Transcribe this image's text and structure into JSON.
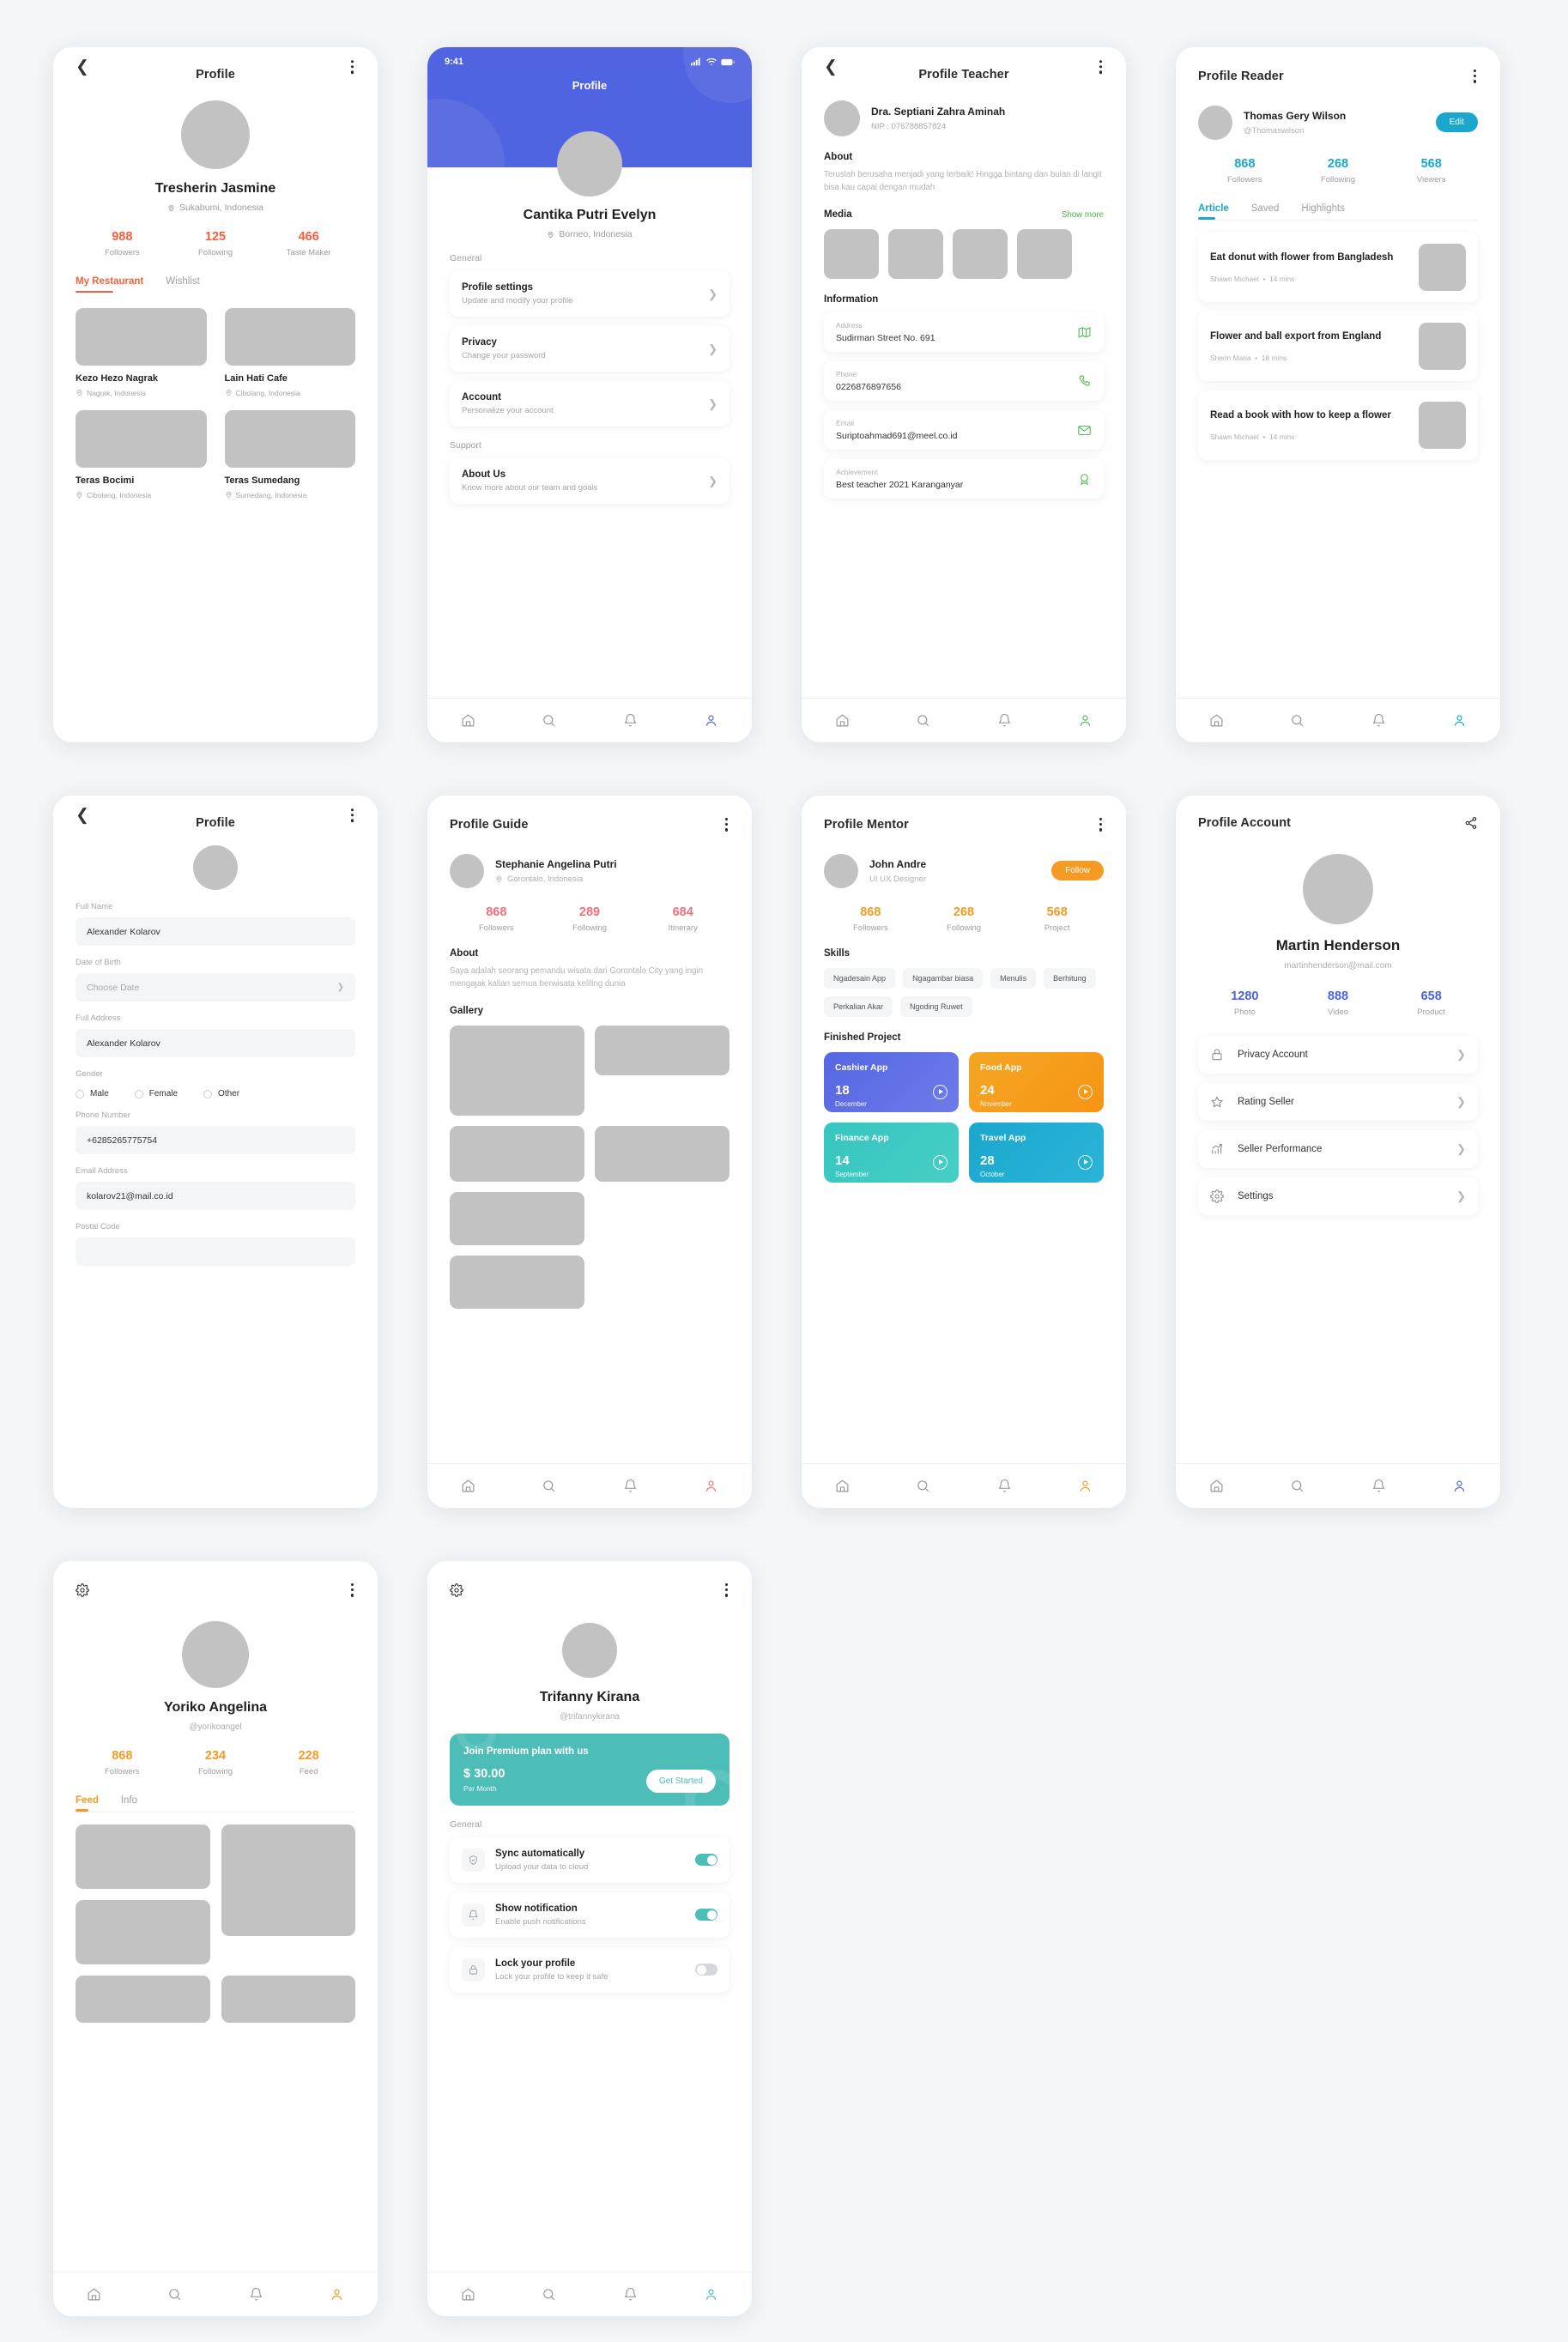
{
  "colors": {
    "orange_red": "#f4603e",
    "blue": "#5063e0",
    "green": "#4cb050",
    "cyan": "#1ba7cd",
    "pink": "#f2707c",
    "amber": "#f59a23",
    "indigo": "#4a62e0",
    "teal": "#4dbdb8",
    "gray_text": "#9e9e9e"
  },
  "screen1": {
    "title": "Profile",
    "user": {
      "name": "Tresherin Jasmine",
      "location": "Sukabumi, Indonesia"
    },
    "stats": [
      {
        "num": "988",
        "label": "Followers"
      },
      {
        "num": "125",
        "label": "Following"
      },
      {
        "num": "466",
        "label": "Taste Maker"
      }
    ],
    "tabs": [
      {
        "label": "My Restaurant",
        "active": true
      },
      {
        "label": "Wishlist",
        "active": false
      }
    ],
    "restaurants": [
      {
        "name": "Kezo Hezo Nagrak",
        "location": "Nagrak, Indonesia"
      },
      {
        "name": "Lain Hati Cafe",
        "location": "Cibolang, Indonesia"
      },
      {
        "name": "Teras Bocimi",
        "location": "Cibolang, Indonesia"
      },
      {
        "name": "Teras Sumedang",
        "location": "Sumedang, Indonesia"
      }
    ]
  },
  "screen2": {
    "status_time": "9:41",
    "title": "Profile",
    "user": {
      "name": "Cantika Putri Evelyn",
      "location": "Borneo, Indonesia"
    },
    "section_general": "General",
    "section_support": "Support",
    "general_items": [
      {
        "title": "Profile settings",
        "subtitle": "Update and modify your profile"
      },
      {
        "title": "Privacy",
        "subtitle": "Change your password"
      },
      {
        "title": "Account",
        "subtitle": "Personalize your account"
      }
    ],
    "support_items": [
      {
        "title": "About Us",
        "subtitle": "Know more about our team and goals"
      }
    ]
  },
  "screen3": {
    "title": "Profile Teacher",
    "user": {
      "name": "Dra. Septiani Zahra Aminah",
      "nip": "NIP : 076788857824"
    },
    "about_heading": "About",
    "about_text": "Teruslah berusaha menjadi yang terbaik! Hingga bintang dan bulan di langit bisa kau capai dengan mudah",
    "media_heading": "Media",
    "show_more": "Show more",
    "information_heading": "Information",
    "info_items": [
      {
        "key": "Address",
        "value": "Sudirman Street No. 691",
        "icon": "map-icon"
      },
      {
        "key": "Phone",
        "value": "0226876897656",
        "icon": "phone-icon"
      },
      {
        "key": "Email",
        "value": "Suriptoahmad691@meel.co.id",
        "icon": "mail-icon"
      },
      {
        "key": "Achievement",
        "value": "Best teacher 2021 Karanganyar",
        "icon": "award-icon"
      }
    ]
  },
  "screen4": {
    "title": "Profile Reader",
    "user": {
      "name": "Thomas Gery Wilson",
      "handle": "@Thomaswilson"
    },
    "edit_label": "Edit",
    "stats": [
      {
        "num": "868",
        "label": "Followers"
      },
      {
        "num": "268",
        "label": "Following"
      },
      {
        "num": "568",
        "label": "Viewers"
      }
    ],
    "tabs": [
      {
        "label": "Article",
        "active": true
      },
      {
        "label": "Saved",
        "active": false
      },
      {
        "label": "Highlights",
        "active": false
      }
    ],
    "articles": [
      {
        "title": "Eat donut with flower from Bangladesh",
        "author": "Shawn Michael",
        "time": "14 mins"
      },
      {
        "title": "Flower and ball export from England",
        "author": "Sherin Maria",
        "time": "18 mins"
      },
      {
        "title": "Read a book with how to keep a flower",
        "author": "Shawn Michael",
        "time": "14 mins"
      }
    ]
  },
  "screen5": {
    "title": "Profile",
    "fields": [
      {
        "label": "Full Name",
        "value": "Alexander Kolarov",
        "type": "text",
        "placeholder": ""
      },
      {
        "label": "Date of Birth",
        "value": "Choose Date",
        "type": "select",
        "placeholder": "Choose Date"
      },
      {
        "label": "Full Address",
        "value": "Alexander Kolarov",
        "type": "text",
        "placeholder": ""
      }
    ],
    "gender_label": "Gender",
    "gender_options": [
      "Male",
      "Female",
      "Other"
    ],
    "fields2": [
      {
        "label": "Phone Number",
        "value": "+6285265775754",
        "type": "text"
      },
      {
        "label": "Email Address",
        "value": "kolarov21@mail.co.id",
        "type": "text"
      },
      {
        "label": "Postal Code",
        "value": "",
        "type": "text"
      }
    ]
  },
  "screen6": {
    "title": "Profile Guide",
    "user": {
      "name": "Stephanie Angelina Putri",
      "location": "Gorontalo, Indonesia"
    },
    "stats": [
      {
        "num": "868",
        "label": "Followers"
      },
      {
        "num": "289",
        "label": "Following"
      },
      {
        "num": "684",
        "label": "Itinerary"
      }
    ],
    "about_heading": "About",
    "about_text": "Saya adalah seorang pemandu wisata dari Gorontalo City yang ingin mengajak kalian semua berwisata keliling dunia",
    "gallery_heading": "Gallery"
  },
  "screen7": {
    "title": "Profile Mentor",
    "user": {
      "name": "John Andre",
      "role": "UI UX Designer"
    },
    "follow_label": "Follow",
    "stats": [
      {
        "num": "868",
        "label": "Followers"
      },
      {
        "num": "268",
        "label": "Following"
      },
      {
        "num": "568",
        "label": "Project"
      }
    ],
    "skills_heading": "Skills",
    "skills": [
      "Ngadesain App",
      "Ngagambar biasa",
      "Menulis",
      "Berhitung",
      "Perkalian Akar",
      "Ngoding Ruwet"
    ],
    "projects_heading": "Finished Project",
    "projects": [
      {
        "title": "Cashier App",
        "day": "18",
        "month": "December",
        "color1": "#5566e4",
        "color2": "#6d7be8"
      },
      {
        "title": "Food App",
        "day": "24",
        "month": "November",
        "color1": "#f5a623",
        "color2": "#f79e1b"
      },
      {
        "title": "Finance App",
        "day": "14",
        "month": "September",
        "color1": "#36c5c0",
        "color2": "#4bcfc2"
      },
      {
        "title": "Travel App",
        "day": "28",
        "month": "October",
        "color1": "#1ba7cd",
        "color2": "#27b4d6"
      }
    ]
  },
  "screen8": {
    "title": "Profile Account",
    "user": {
      "name": "Martin Henderson",
      "email": "martinhenderson@mail.com"
    },
    "stats": [
      {
        "num": "1280",
        "label": "Photo"
      },
      {
        "num": "888",
        "label": "Video"
      },
      {
        "num": "658",
        "label": "Product"
      }
    ],
    "menu": [
      {
        "label": "Privacy Account",
        "icon": "lock-icon"
      },
      {
        "label": "Rating Seller",
        "icon": "star-icon"
      },
      {
        "label": "Seller Performance",
        "icon": "chart-up-icon"
      },
      {
        "label": "Settings",
        "icon": "gear-icon"
      }
    ]
  },
  "screen9": {
    "user": {
      "name": "Yoriko Angelina",
      "handle": "@yorikoangel"
    },
    "stats": [
      {
        "num": "868",
        "label": "Followers"
      },
      {
        "num": "234",
        "label": "Following"
      },
      {
        "num": "228",
        "label": "Feed"
      }
    ],
    "tabs": [
      {
        "label": "Feed",
        "active": true
      },
      {
        "label": "Info",
        "active": false
      }
    ]
  },
  "screen10": {
    "user": {
      "name": "Trifanny Kirana",
      "handle": "@trifannykirana"
    },
    "premium": {
      "headline": "Join Premium plan with us",
      "price": "$ 30.00",
      "period": "Per Month",
      "cta": "Get Started"
    },
    "section_general": "General",
    "settings": [
      {
        "title": "Sync automatically",
        "subtitle": "Upload your data to cloud",
        "icon": "shield-check-icon",
        "on": true
      },
      {
        "title": "Show notification",
        "subtitle": "Enable push notifications",
        "icon": "bell-icon",
        "on": true
      },
      {
        "title": "Lock your profile",
        "subtitle": "Lock your profile to keep it safe",
        "icon": "lock-icon",
        "on": false
      }
    ]
  },
  "bottom_nav": [
    "home-icon",
    "search-icon",
    "bell-icon",
    "user-icon"
  ]
}
